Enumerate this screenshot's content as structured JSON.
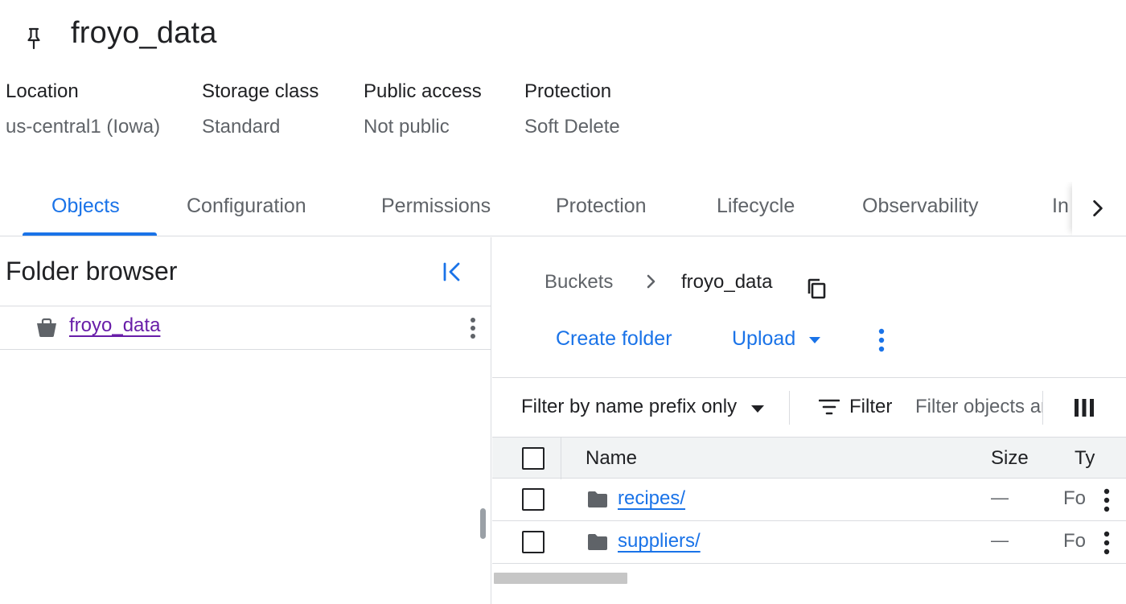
{
  "header": {
    "title": "froyo_data",
    "pin_icon": "pin-icon"
  },
  "meta": [
    {
      "label": "Location",
      "value": "us-central1 (Iowa)"
    },
    {
      "label": "Storage class",
      "value": "Standard"
    },
    {
      "label": "Public access",
      "value": "Not public"
    },
    {
      "label": "Protection",
      "value": "Soft Delete"
    }
  ],
  "tabs": [
    {
      "label": "Objects",
      "active": true
    },
    {
      "label": "Configuration"
    },
    {
      "label": "Permissions"
    },
    {
      "label": "Protection"
    },
    {
      "label": "Lifecycle"
    },
    {
      "label": "Observability"
    },
    {
      "label": "In"
    }
  ],
  "folder_browser": {
    "title": "Folder browser",
    "items": [
      {
        "label": "froyo_data",
        "icon": "bucket-icon"
      }
    ]
  },
  "breadcrumb": {
    "root": "Buckets",
    "current": "froyo_data"
  },
  "actions": {
    "create_folder": "Create folder",
    "upload": "Upload"
  },
  "filterbar": {
    "prefix_label": "Filter by name prefix only",
    "filter_label": "Filter",
    "filter_placeholder": "Filter objects and folders"
  },
  "table": {
    "headers": {
      "name": "Name",
      "size": "Size",
      "type": "Ty"
    },
    "rows": [
      {
        "name": "recipes/",
        "size": "—",
        "type": "Fo"
      },
      {
        "name": "suppliers/",
        "size": "—",
        "type": "Fo"
      }
    ]
  },
  "colors": {
    "accent": "#1a73e8",
    "visited_link": "#681da8",
    "text": "#202124",
    "muted": "#5f6368",
    "border": "#dadce0"
  }
}
